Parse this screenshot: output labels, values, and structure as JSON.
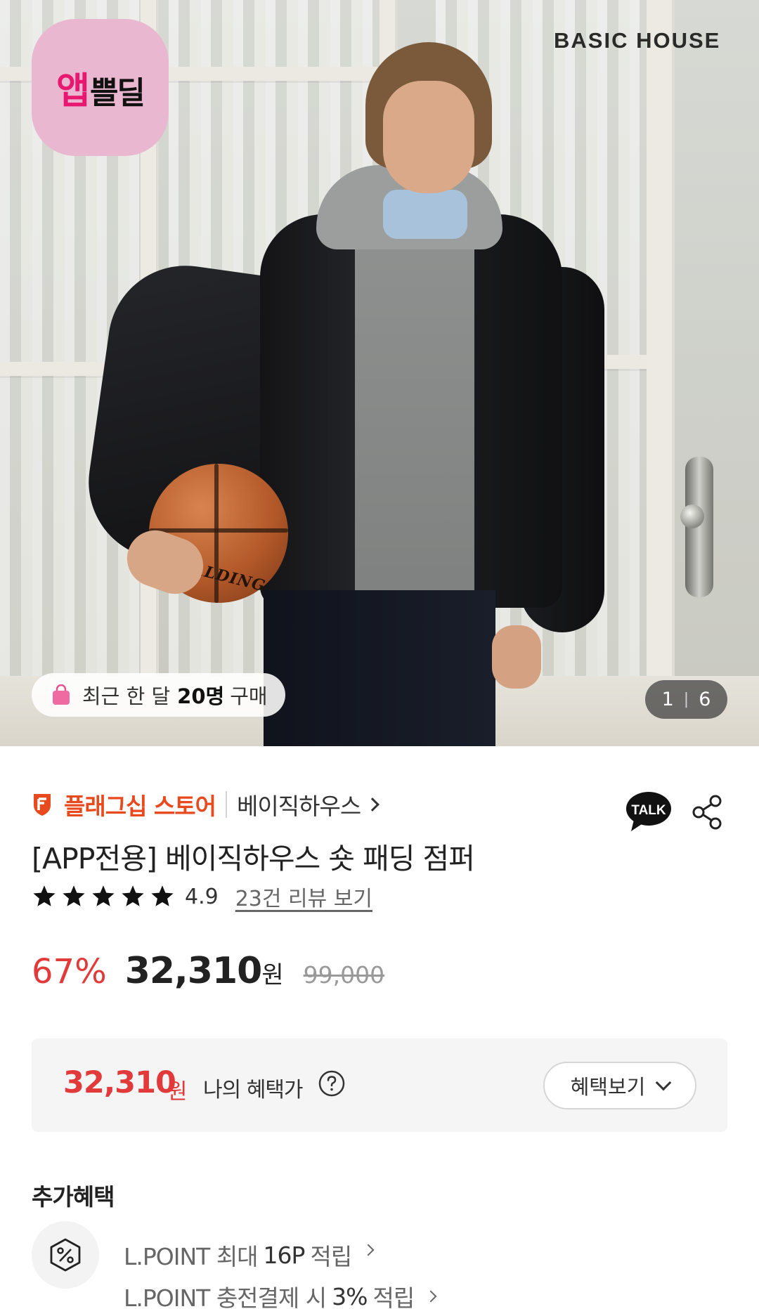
{
  "hero": {
    "app_badge": {
      "part1": "앱",
      "part2": "쁠딜",
      "color": "#e8176f",
      "bg": "#e9b7cf"
    },
    "brand_wordmark": "BASIC HOUSE",
    "ball_print": "SPALDING",
    "purchase_badge": {
      "prefix": "최근 한 달",
      "count": "20명",
      "suffix": "구매",
      "icon": "shopping-bag-icon"
    },
    "page_indicator": {
      "current": "1",
      "separator": "|",
      "total": "6"
    }
  },
  "store": {
    "label": "플래그십 스토어",
    "brand": "베이직하우스",
    "accent_color": "#e84a1e",
    "icons": [
      "flag-icon",
      "kakao-talk-icon",
      "share-icon"
    ]
  },
  "product": {
    "title": "[APP전용] 베이직하우스 숏 패딩 점퍼",
    "rating": "4.9",
    "star_count": 5,
    "review_link": "23건 리뷰 보기"
  },
  "price": {
    "discount": "67%",
    "sale": "32,310",
    "unit": "원",
    "original": "99,000",
    "accent_color": "#e23a3a"
  },
  "benefit": {
    "price": "32,310",
    "unit": "원",
    "label": "나의 혜택가",
    "button": "혜택보기"
  },
  "extra": {
    "title": "추가혜택",
    "icon": "percent-icon",
    "rows": [
      {
        "prefix": "L.POINT 최대",
        "value": "16P",
        "suffix": "적립"
      },
      {
        "prefix": "L.POINT 충전결제 시",
        "value": "3%",
        "suffix": "적립"
      }
    ]
  }
}
